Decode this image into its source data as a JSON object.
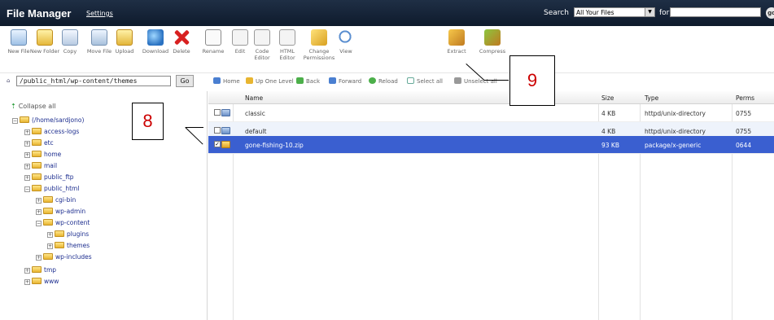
{
  "topbar": {
    "title": "File Manager",
    "settings": "Settings",
    "search_label": "Search",
    "search_scope": "All Your Files",
    "for_label": "for",
    "search_value": "",
    "go_label": "go"
  },
  "toolbar": [
    {
      "label": "New File",
      "icon": "new-file-icon"
    },
    {
      "label": "New Folder",
      "icon": "new-folder-icon"
    },
    {
      "label": "Copy",
      "icon": "copy-icon"
    },
    {
      "label": "Move File",
      "icon": "move-file-icon"
    },
    {
      "label": "Upload",
      "icon": "upload-icon"
    },
    {
      "label": "Download",
      "icon": "download-icon"
    },
    {
      "label": "Delete",
      "icon": "delete-icon"
    },
    {
      "label": "Rename",
      "icon": "rename-icon"
    },
    {
      "label": "Edit",
      "icon": "edit-icon"
    },
    {
      "label": "Code Editor",
      "icon": "code-editor-icon"
    },
    {
      "label": "HTML Editor",
      "icon": "html-editor-icon"
    },
    {
      "label": "Change Permissions",
      "icon": "permissions-icon"
    },
    {
      "label": "View",
      "icon": "view-icon"
    },
    {
      "label": "Extract",
      "icon": "extract-icon"
    },
    {
      "label": "Compress",
      "icon": "compress-icon"
    }
  ],
  "pathbar": {
    "path": "/public_html/wp-content/themes",
    "go": "Go"
  },
  "navbar": {
    "home": "Home",
    "up": "Up One Level",
    "back": "Back",
    "forward": "Forward",
    "reload": "Reload",
    "select_all": "Select all",
    "unselect_all": "Unselect all"
  },
  "tree": {
    "collapse": "Collapse all",
    "root": "(/home/sardjono)",
    "items": [
      "access-logs",
      "etc",
      "home",
      "mail",
      "public_ftp",
      "public_html",
      "cgi-bin",
      "wp-admin",
      "wp-content",
      "plugins",
      "themes",
      "wp-includes",
      "tmp",
      "www"
    ]
  },
  "files": {
    "columns": {
      "name": "Name",
      "size": "Size",
      "type": "Type",
      "perms": "Perms"
    },
    "rows": [
      {
        "name": "classic",
        "size": "4 KB",
        "type": "httpd/unix-directory",
        "perms": "0755",
        "checked": false,
        "selected": false
      },
      {
        "name": "default",
        "size": "4 KB",
        "type": "httpd/unix-directory",
        "perms": "0755",
        "checked": false,
        "selected": false
      },
      {
        "name": "gone-fishing-10.zip",
        "size": "93 KB",
        "type": "package/x-generic",
        "perms": "0644",
        "checked": true,
        "selected": true
      }
    ]
  },
  "callouts": {
    "eight": "8",
    "nine": "9"
  },
  "colors": {
    "selected_row": "#3a5fd0",
    "topbar": "#14233a",
    "callout_text": "#cc0000"
  }
}
